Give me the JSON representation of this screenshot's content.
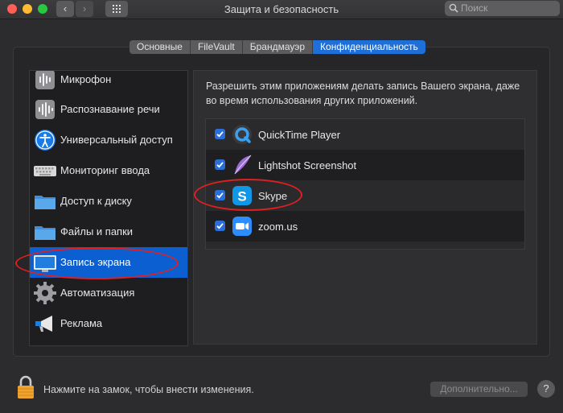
{
  "window": {
    "title": "Защита и безопасность",
    "search_placeholder": "Поиск"
  },
  "tabs": [
    "Основные",
    "FileVault",
    "Брандмауэр",
    "Конфиденциальность"
  ],
  "active_tab": "Конфиденциальность",
  "sidebar": {
    "items": [
      {
        "label": "Микрофон",
        "icon": "microphone-icon"
      },
      {
        "label": "Распознавание речи",
        "icon": "speech-recognition-icon"
      },
      {
        "label": "Универсальный доступ",
        "icon": "accessibility-icon"
      },
      {
        "label": "Мониторинг ввода",
        "icon": "keyboard-icon"
      },
      {
        "label": "Доступ к диску",
        "icon": "folder-icon"
      },
      {
        "label": "Файлы и папки",
        "icon": "folder-icon"
      },
      {
        "label": "Запись экрана",
        "icon": "display-icon"
      },
      {
        "label": "Автоматизация",
        "icon": "gear-icon"
      },
      {
        "label": "Реклама",
        "icon": "megaphone-icon"
      }
    ],
    "selected": "Запись экрана"
  },
  "panel": {
    "description": "Разрешить этим приложениям делать запись Вашего экрана, даже во время использования других приложений.",
    "apps": [
      {
        "name": "QuickTime Player",
        "checked": true,
        "icon": "quicktime-icon"
      },
      {
        "name": "Lightshot Screenshot",
        "checked": true,
        "icon": "lightshot-feather-icon"
      },
      {
        "name": "Skype",
        "checked": true,
        "icon": "skype-icon"
      },
      {
        "name": "zoom.us",
        "checked": true,
        "icon": "zoom-camera-icon"
      }
    ]
  },
  "footer": {
    "lock_text": "Нажмите на замок, чтобы внести изменения.",
    "advanced_label": "Дополнительно...",
    "help_label": "?"
  },
  "colors": {
    "accent": "#0b5fd1",
    "annotation": "#e02020"
  }
}
